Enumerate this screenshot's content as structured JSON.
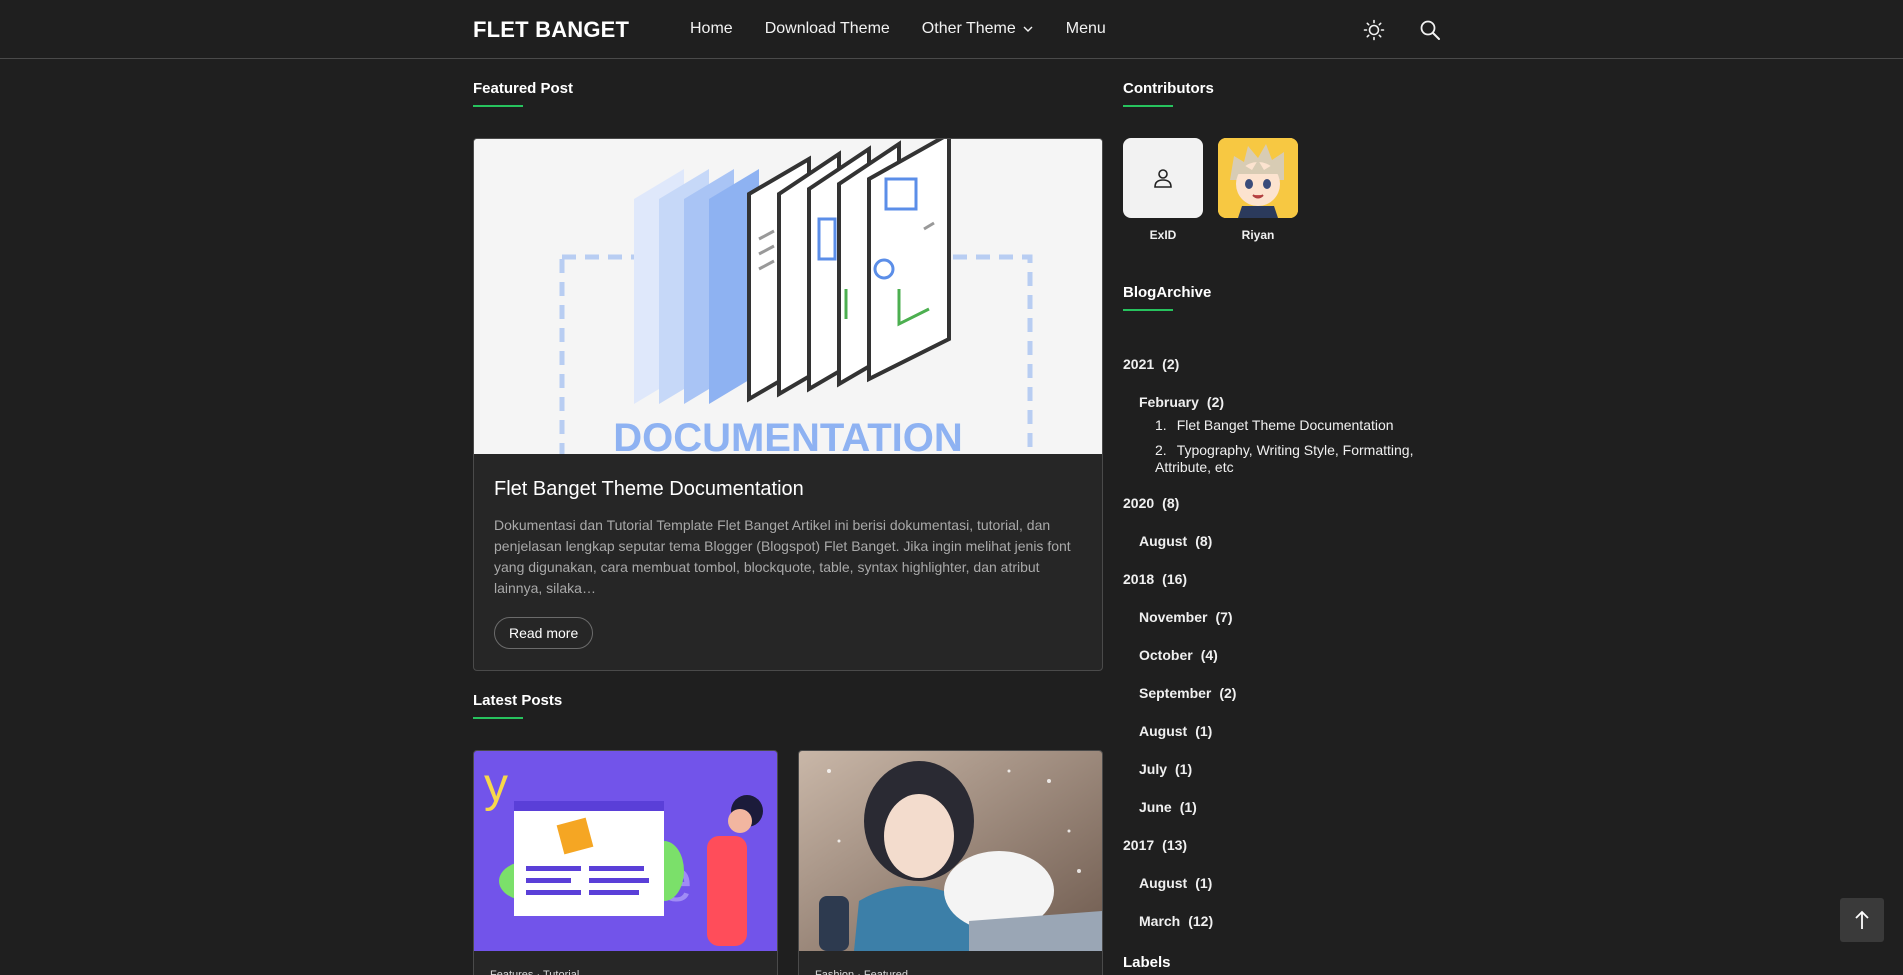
{
  "header": {
    "brand": "FLET BANGET",
    "nav": [
      {
        "label": "Home"
      },
      {
        "label": "Download Theme"
      },
      {
        "label": "Other Theme"
      },
      {
        "label": "Menu"
      }
    ],
    "theme_icon": "sun-icon",
    "search_icon": "search-icon"
  },
  "featured": {
    "heading": "Featured Post",
    "image_text": "DOCUMENTATION",
    "title": "Flet Banget Theme Documentation",
    "excerpt": "Dokumentasi dan Tutorial Template Flet Banget Artikel ini berisi dokumentasi, tutorial, dan penjelasan lengkap seputar tema Blogger (Blogspot) Flet Banget. Jika ingin melihat jenis font yang digunakan, cara membuat tombol, blockquote, table, syntax highlighter, dan atribut lainnya, silaka…",
    "read_more": "Read more"
  },
  "latest": {
    "heading": "Latest Posts",
    "posts": [
      {
        "tags": "Features · Tutorial"
      },
      {
        "tags": "Fashion · Featured"
      }
    ]
  },
  "contributors": {
    "heading": "Contributors",
    "people": [
      {
        "name": "ExID",
        "avatar": "user-icon"
      },
      {
        "name": "Riyan",
        "avatar": "anime-avatar"
      }
    ]
  },
  "archive": {
    "heading": "BlogArchive",
    "years": [
      {
        "year": "2021",
        "count": "(2)",
        "months": [
          {
            "month": "February",
            "count": "(2)",
            "posts": [
              {
                "num": "1.",
                "title": "Flet Banget Theme Documentation"
              },
              {
                "num": "2.",
                "title": "Typography, Writing Style, Formatting, Attribute, etc"
              }
            ]
          }
        ]
      },
      {
        "year": "2020",
        "count": "(8)",
        "months": [
          {
            "month": "August",
            "count": "(8)"
          }
        ]
      },
      {
        "year": "2018",
        "count": "(16)",
        "months": [
          {
            "month": "November",
            "count": "(7)"
          },
          {
            "month": "October",
            "count": "(4)"
          },
          {
            "month": "September",
            "count": "(2)"
          },
          {
            "month": "August",
            "count": "(1)"
          },
          {
            "month": "July",
            "count": "(1)"
          },
          {
            "month": "June",
            "count": "(1)"
          }
        ]
      },
      {
        "year": "2017",
        "count": "(13)",
        "months": [
          {
            "month": "August",
            "count": "(1)"
          },
          {
            "month": "March",
            "count": "(12)"
          }
        ]
      }
    ]
  },
  "labels": {
    "heading": "Labels"
  },
  "colors": {
    "background": "#1f1f1f",
    "accent": "#27c35e",
    "border": "#4a4a4a",
    "muted_text": "#a9a9a9"
  },
  "back_to_top_icon": "arrow-up-icon"
}
